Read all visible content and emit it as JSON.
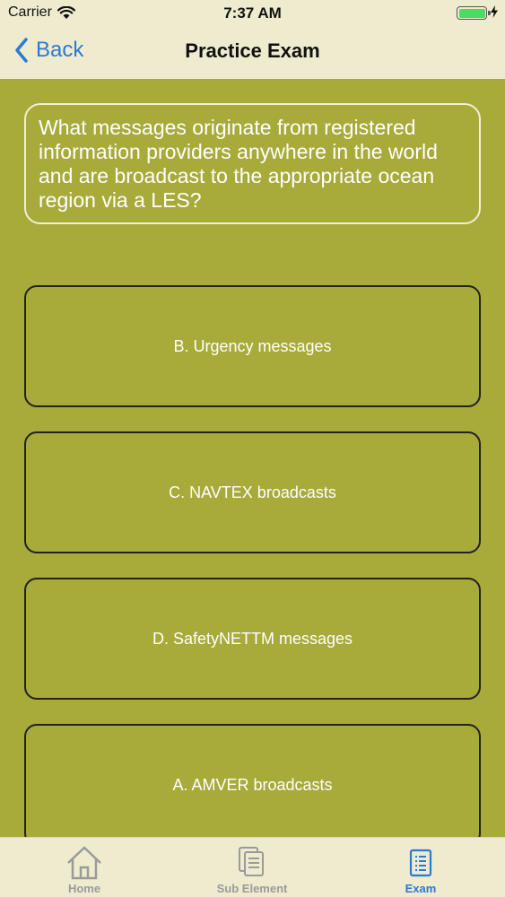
{
  "status": {
    "carrier": "Carrier",
    "time": "7:37 AM",
    "battery_level": 1.0
  },
  "nav": {
    "back_label": "Back",
    "title": "Practice Exam"
  },
  "question": {
    "text": "What messages originate from registered information providers anywhere in the world and are broadcast to the appropriate ocean region via a LES?"
  },
  "answers": [
    {
      "label": "B. Urgency messages"
    },
    {
      "label": "C. NAVTEX broadcasts"
    },
    {
      "label": "D. SafetyNETTM messages"
    },
    {
      "label": "A. AMVER broadcasts"
    }
  ],
  "tabs": [
    {
      "label": "Home",
      "icon": "home-icon",
      "active": false
    },
    {
      "label": "Sub Element",
      "icon": "documents-icon",
      "active": false
    },
    {
      "label": "Exam",
      "icon": "list-icon",
      "active": true
    }
  ],
  "colors": {
    "background": "#a8aa3a",
    "bar": "#efebcf",
    "accent": "#2a7ad6"
  }
}
